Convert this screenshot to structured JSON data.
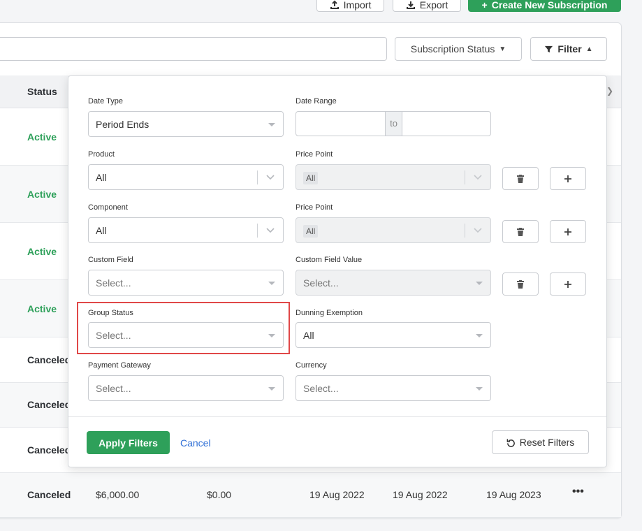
{
  "header": {
    "import_label": "Import",
    "export_label": "Export",
    "create_label": "Create New Subscription"
  },
  "toolbar": {
    "search_value": "",
    "subscription_status_label": "Subscription Status",
    "filter_label": "Filter"
  },
  "table": {
    "status_header": "Status",
    "rows": [
      {
        "status": "Active"
      },
      {
        "status": "Active"
      },
      {
        "status": "Active"
      },
      {
        "status": "Active"
      },
      {
        "status": "Canceled"
      },
      {
        "status": "Canceled"
      },
      {
        "status": "Canceled"
      },
      {
        "status": "Canceled",
        "amount": "$6,000.00",
        "balance": "$0.00",
        "date1": "19 Aug 2022",
        "date2": "19 Aug 2022",
        "date3": "19 Aug 2023"
      }
    ]
  },
  "filters": {
    "date_type": {
      "label": "Date Type",
      "value": "Period Ends"
    },
    "date_range": {
      "label": "Date Range",
      "from": "",
      "to_label": "to",
      "to": ""
    },
    "product": {
      "label": "Product",
      "value": "All"
    },
    "product_price_point": {
      "label": "Price Point",
      "value": "All"
    },
    "component": {
      "label": "Component",
      "value": "All"
    },
    "component_price_point": {
      "label": "Price Point",
      "value": "All"
    },
    "custom_field": {
      "label": "Custom Field",
      "placeholder": "Select..."
    },
    "custom_field_value": {
      "label": "Custom Field Value",
      "placeholder": "Select..."
    },
    "group_status": {
      "label": "Group Status",
      "placeholder": "Select..."
    },
    "dunning_exemption": {
      "label": "Dunning Exemption",
      "value": "All"
    },
    "payment_gateway": {
      "label": "Payment Gateway",
      "placeholder": "Select..."
    },
    "currency": {
      "label": "Currency",
      "placeholder": "Select..."
    },
    "apply_label": "Apply Filters",
    "cancel_label": "Cancel",
    "reset_label": "Reset Filters"
  },
  "colors": {
    "primary": "#2ea05a",
    "link": "#2f6fd6",
    "highlight": "#e04848"
  }
}
